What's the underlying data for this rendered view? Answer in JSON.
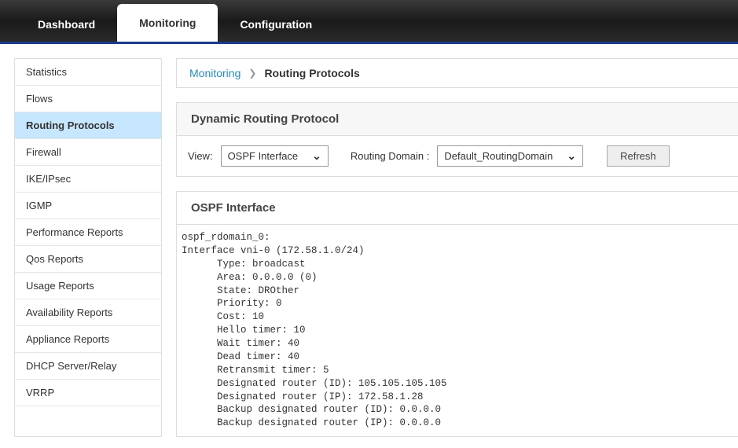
{
  "topnav": {
    "items": [
      {
        "label": "Dashboard"
      },
      {
        "label": "Monitoring"
      },
      {
        "label": "Configuration"
      }
    ]
  },
  "sidebar": {
    "items": [
      {
        "label": "Statistics"
      },
      {
        "label": "Flows"
      },
      {
        "label": "Routing Protocols"
      },
      {
        "label": "Firewall"
      },
      {
        "label": "IKE/IPsec"
      },
      {
        "label": "IGMP"
      },
      {
        "label": "Performance Reports"
      },
      {
        "label": "Qos Reports"
      },
      {
        "label": "Usage Reports"
      },
      {
        "label": "Availability Reports"
      },
      {
        "label": "Appliance Reports"
      },
      {
        "label": "DHCP Server/Relay"
      },
      {
        "label": "VRRP"
      }
    ]
  },
  "breadcrumb": {
    "parent": "Monitoring",
    "current": "Routing Protocols"
  },
  "panel1": {
    "title": "Dynamic Routing Protocol",
    "view_label": "View:",
    "view_value": "OSPF Interface",
    "rd_label": "Routing Domain :",
    "rd_value": "Default_RoutingDomain",
    "refresh": "Refresh"
  },
  "panel2": {
    "title": "OSPF Interface",
    "text": "ospf_rdomain_0:\nInterface vni-0 (172.58.1.0/24)\n      Type: broadcast\n      Area: 0.0.0.0 (0)\n      State: DROther\n      Priority: 0\n      Cost: 10\n      Hello timer: 10\n      Wait timer: 40\n      Dead timer: 40\n      Retransmit timer: 5\n      Designated router (ID): 105.105.105.105\n      Designated router (IP): 172.58.1.28\n      Backup designated router (ID): 0.0.0.0\n      Backup designated router (IP): 0.0.0.0"
  }
}
